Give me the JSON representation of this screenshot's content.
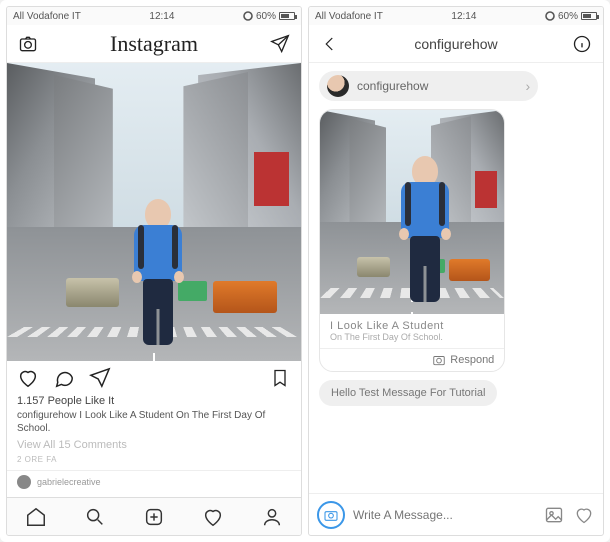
{
  "status": {
    "carrier": "All Vodafone IT",
    "time": "12:14",
    "battery_pct": "60%"
  },
  "left": {
    "brand": "Instagram",
    "likes": "1.157 People Like It",
    "caption": "configurehow I Look Like A Student On The First Day Of School.",
    "view_comments": "View All 15 Comments",
    "time": "2 ORE FA",
    "feed_user": "gabrielecreative"
  },
  "right": {
    "title": "configurehow",
    "card_user": "configurehow",
    "card_title": "I Look Like A Student",
    "card_sub": "On The First Day Of School.",
    "respond": "Respond",
    "message": "Hello Test Message For Tutorial",
    "placeholder": "Write A Message..."
  }
}
